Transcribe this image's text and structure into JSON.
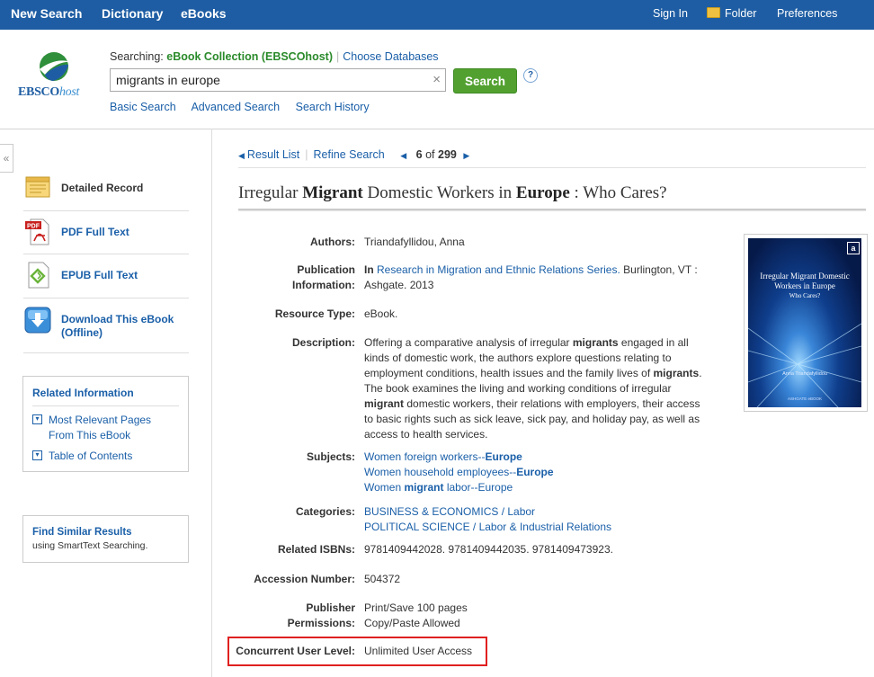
{
  "topnav": {
    "new_search": "New Search",
    "dictionary": "Dictionary",
    "ebooks": "eBooks",
    "sign_in": "Sign In",
    "folder": "Folder",
    "preferences": "Preferences"
  },
  "logo": {
    "brand": "EBSCO",
    "suffix": "host"
  },
  "search": {
    "searching_label": "Searching:",
    "database": "eBook Collection (EBSCOhost)",
    "choose_databases": "Choose Databases",
    "query": "migrants in europe",
    "clear": "×",
    "button": "Search",
    "help": "?",
    "basic": "Basic Search",
    "advanced": "Advanced Search",
    "history": "Search History"
  },
  "sidebar": {
    "collapse": "«",
    "items": [
      {
        "label": "Detailed Record"
      },
      {
        "label": "PDF Full Text",
        "badge": "PDF"
      },
      {
        "label": "EPUB Full Text"
      },
      {
        "label": "Download This eBook (Offline)"
      }
    ],
    "related": {
      "title": "Related Information",
      "links": [
        "Most Relevant Pages From This eBook",
        "Table of Contents"
      ]
    },
    "similar": {
      "title": "Find Similar Results",
      "desc": "using SmartText Searching."
    }
  },
  "result_nav": {
    "result_list": "Result List",
    "refine": "Refine Search",
    "current": "6",
    "of": "of",
    "total": "299"
  },
  "record": {
    "title_parts": [
      "Irregular ",
      "Migrant",
      " Domestic Workers in ",
      "Europe",
      " : Who Cares?"
    ],
    "fields": {
      "authors_label": "Authors:",
      "authors": "Triandafyllidou, Anna",
      "pub_label_1": "Publication",
      "pub_label_2": "Information:",
      "pub_in": "In",
      "pub_series": "Research in Migration and Ethnic Relations Series.",
      "pub_rest_1": " Burlington, VT :",
      "pub_rest_2": "Ashgate. 2013",
      "resource_label": "Resource Type:",
      "resource": "eBook.",
      "desc_label": "Description:",
      "desc_lines": [
        [
          "Offering a comparative analysis of irregular ",
          "migrants",
          " engaged in all"
        ],
        [
          "kinds of domestic work, the authors explore questions relating to",
          "",
          ""
        ],
        [
          "employment conditions, health issues and the family lives of ",
          "migrants",
          "."
        ],
        [
          "The book examines the living and working conditions of irregular",
          "",
          ""
        ],
        [
          "",
          "migrant",
          " domestic workers, their relations with employers, their access"
        ],
        [
          "to basic rights such as sick leave, sick pay, and holiday pay, as well as",
          "",
          ""
        ],
        [
          "access to health services.",
          "",
          ""
        ]
      ],
      "subjects_label": "Subjects:",
      "subjects": [
        [
          "Women foreign workers--",
          "Europe",
          ""
        ],
        [
          "Women household employees--",
          "Europe",
          ""
        ],
        [
          "Women ",
          "migrant",
          " labor--Europe"
        ]
      ],
      "categories_label": "Categories:",
      "categories": [
        "BUSINESS & ECONOMICS / Labor",
        "POLITICAL SCIENCE / Labor & Industrial Relations"
      ],
      "isbn_label": "Related ISBNs:",
      "isbns": "9781409442028. 9781409442035. 9781409473923.",
      "accession_label": "Accession Number:",
      "accession": "504372",
      "perm_label_1": "Publisher",
      "perm_label_2": "Permissions:",
      "perm_1": "Print/Save 100 pages",
      "perm_2": "Copy/Paste Allowed",
      "concurrent_label": "Concurrent User Level:",
      "concurrent": "Unlimited User Access"
    },
    "cover": {
      "title": "Irregular Migrant Domestic Workers in Europe",
      "subtitle": "Who Cares?",
      "author": "Anna Triandafyllidou",
      "publisher": "ASHGATE eBOOK",
      "badge": "a"
    }
  }
}
